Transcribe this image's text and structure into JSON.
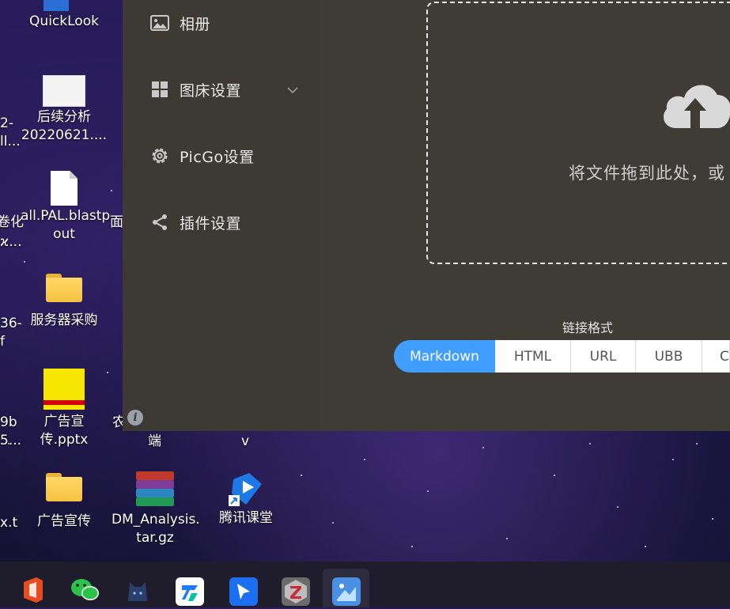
{
  "desktop": {
    "icons": [
      {
        "label": "QuickLook"
      },
      {
        "label": "后续分析\n20220621...."
      },
      {
        "label": "all.PAL.blastp\nout"
      },
      {
        "label": "服务器采购"
      },
      {
        "label": "广告宣\n传.pptx"
      },
      {
        "label": "广告宣传"
      },
      {
        "label": "DM_Analysis.\ntar.gz"
      },
      {
        "label": "腾讯课堂"
      }
    ],
    "clipped_labels": {
      "c1": "2-",
      "c2": "ll...",
      "c3": "卷化",
      "c4": "ϰ...",
      "c5": "面",
      "c6": "36-",
      "c7": "f",
      "c8": "9b",
      "c9": "5...",
      "c10": "农",
      "c11": "端",
      "c12": "v",
      "c13": "x.t"
    }
  },
  "app": {
    "sidebar": {
      "items": [
        {
          "label": "相册",
          "icon": "image-icon"
        },
        {
          "label": "图床设置",
          "icon": "grid-icon"
        },
        {
          "label": "PicGo设置",
          "icon": "gear-icon"
        },
        {
          "label": "插件设置",
          "icon": "share-icon"
        }
      ]
    },
    "upload": {
      "drop_text": "将文件拖到此处，或",
      "icon": "cloud-upload-icon"
    },
    "link_format": {
      "title": "链接格式",
      "options": [
        "Markdown",
        "HTML",
        "URL",
        "UBB",
        "C"
      ],
      "selected": "Markdown"
    }
  },
  "colors": {
    "accent": "#409eff",
    "window_bg": "#3f3b35"
  },
  "taskbar": {
    "apps": [
      "office-icon",
      "wechat-icon",
      "cat-icon",
      "tencent-docs-icon",
      "feishu-icon",
      "zotero-icon",
      "picgo-icon"
    ]
  }
}
